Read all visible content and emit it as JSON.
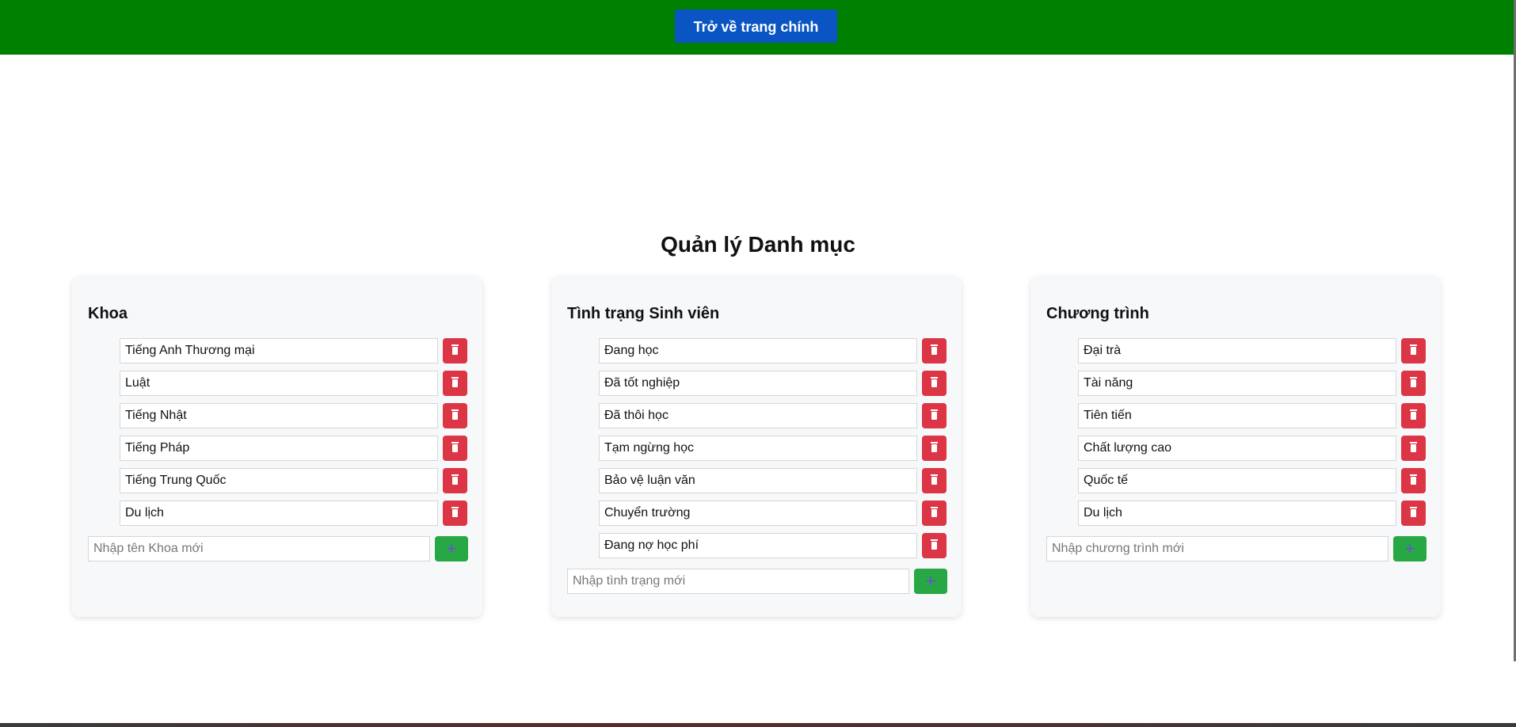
{
  "header": {
    "home_button_label": "Trở về trang chính"
  },
  "page_title": "Quản lý Danh mục",
  "colors": {
    "header_bg": "#008000",
    "home_button_bg": "#0a55c3",
    "delete_button_bg": "#dc3545",
    "add_button_bg": "#28a745",
    "card_bg": "#f7f8fa"
  },
  "cards": [
    {
      "title": "Khoa",
      "items": [
        "Tiếng Anh Thương mại",
        "Luật",
        "Tiếng Nhật",
        "Tiếng Pháp",
        "Tiếng Trung Quốc",
        "Du lịch"
      ],
      "new_placeholder": "Nhập tên Khoa mới",
      "add_icon": "+"
    },
    {
      "title": "Tình trạng Sinh viên",
      "items": [
        "Đang học",
        "Đã tốt nghiệp",
        "Đã thôi học",
        "Tạm ngừng học",
        "Bảo vệ luận văn",
        "Chuyển trường",
        "Đang nợ học phí"
      ],
      "new_placeholder": "Nhập tình trạng mới",
      "add_icon": "+"
    },
    {
      "title": "Chương trình",
      "items": [
        "Đại trà",
        "Tài năng",
        "Tiên tiến",
        "Chất lượng cao",
        "Quốc tế",
        "Du lịch"
      ],
      "new_placeholder": "Nhập chương trình mới",
      "add_icon": "+"
    }
  ]
}
